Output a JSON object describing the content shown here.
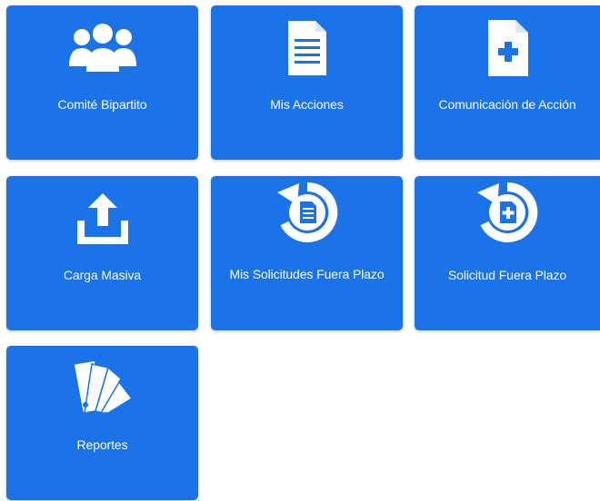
{
  "colors": {
    "tile_background": "#1a73e8",
    "tile_text": "#ffffff",
    "page_background": "#ffffff"
  },
  "tiles": [
    {
      "label": "Comité Bipartito",
      "icon": "group-icon"
    },
    {
      "label": "Mis Acciones",
      "icon": "document-icon"
    },
    {
      "label": "Comunicación de Acción",
      "icon": "document-add-icon"
    },
    {
      "label": "Carga Masiva",
      "icon": "upload-icon"
    },
    {
      "label": "Mis Solicitudes Fuera Plazo",
      "icon": "history-document-icon"
    },
    {
      "label": "Solicitud Fuera Plazo",
      "icon": "history-document-add-icon"
    },
    {
      "label": "Reportes",
      "icon": "color-swatch-icon"
    }
  ]
}
